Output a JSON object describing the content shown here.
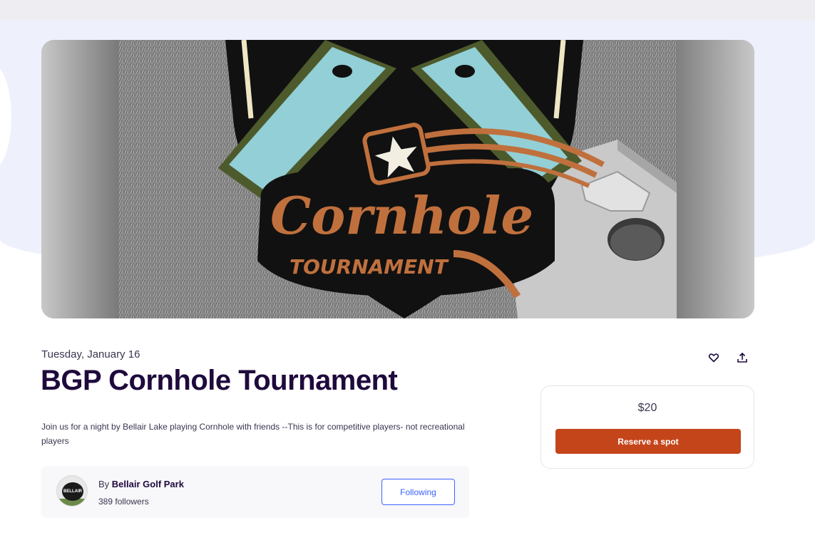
{
  "event": {
    "date": "Tuesday, January 16",
    "title": "BGP Cornhole Tournament",
    "description": "Join us for a night by Bellair Lake playing Cornhole with friends --This is for competitive players- not recreational players"
  },
  "hero": {
    "logo_script_text": "Cornhole",
    "logo_subtitle": "TOURNAMENT"
  },
  "organizer": {
    "by_label": "By",
    "name": "Bellair Golf Park",
    "followers": "389 followers",
    "follow_button": "Following",
    "avatar_text": "BELLAIR"
  },
  "ticket": {
    "price": "$20",
    "reserve_button": "Reserve a spot"
  },
  "actions": {
    "like_icon": "heart-icon",
    "share_icon": "share-icon"
  },
  "colors": {
    "accent_orange": "#c5451b",
    "follow_blue": "#3d64ff",
    "title_dark": "#1e0a3c"
  }
}
